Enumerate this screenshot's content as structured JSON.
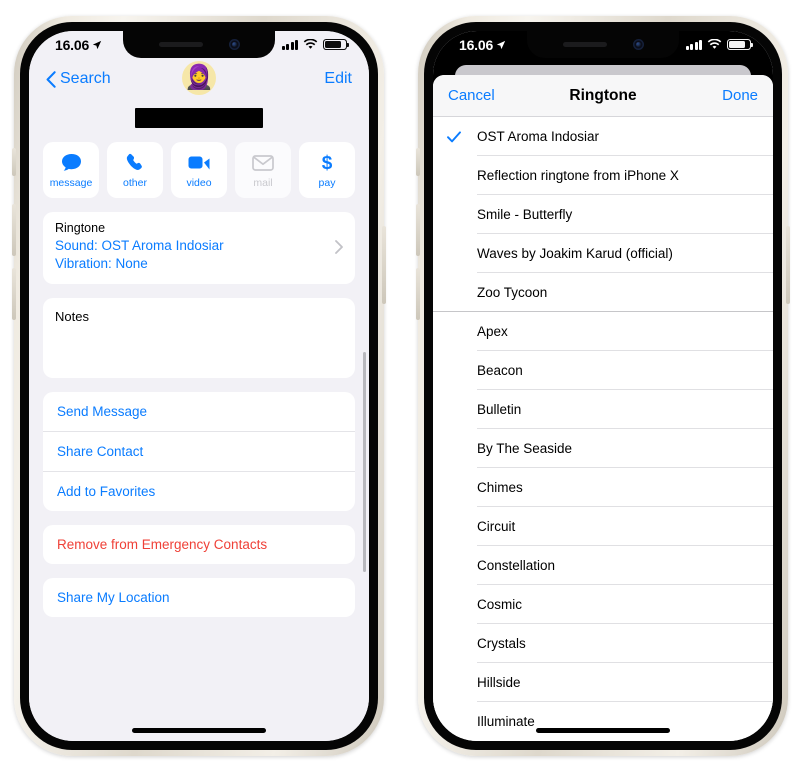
{
  "left_phone": {
    "status_bar": {
      "time": "16.06",
      "location_icon": "location-arrow-icon",
      "signal_icon": "cellular-bars-icon",
      "wifi_icon": "wifi-icon",
      "battery_icon": "battery-icon"
    },
    "nav": {
      "back_label": "Search",
      "back_icon": "chevron-left-icon",
      "avatar_icon": "contact-avatar-emoji",
      "avatar_glyph": "🧕",
      "edit_label": "Edit"
    },
    "contact_name_redacted": true,
    "actions": [
      {
        "label": "message",
        "icon": "message-bubble-icon",
        "enabled": true
      },
      {
        "label": "other",
        "icon": "phone-handset-icon",
        "enabled": true
      },
      {
        "label": "video",
        "icon": "video-camera-icon",
        "enabled": true
      },
      {
        "label": "mail",
        "icon": "envelope-icon",
        "enabled": false
      },
      {
        "label": "pay",
        "icon": "dollar-sign-icon",
        "enabled": true
      }
    ],
    "ringtone_cell": {
      "title": "Ringtone",
      "sound_line": "Sound: OST Aroma Indosiar",
      "vibration_line": "Vibration: None",
      "disclosure_icon": "chevron-right-icon"
    },
    "notes_cell": {
      "label": "Notes"
    },
    "link_groups": [
      {
        "items": [
          {
            "label": "Send Message",
            "style": "default"
          },
          {
            "label": "Share Contact",
            "style": "default"
          },
          {
            "label": "Add to Favorites",
            "style": "default"
          }
        ]
      },
      {
        "items": [
          {
            "label": "Remove from Emergency Contacts",
            "style": "destructive"
          }
        ]
      },
      {
        "items": [
          {
            "label": "Share My Location",
            "style": "default"
          }
        ]
      }
    ]
  },
  "right_phone": {
    "status_bar": {
      "time": "16.06",
      "location_icon": "location-arrow-icon",
      "signal_icon": "cellular-bars-icon",
      "wifi_icon": "wifi-icon",
      "battery_icon": "battery-icon"
    },
    "sheet": {
      "cancel_label": "Cancel",
      "title": "Ringtone",
      "done_label": "Done",
      "check_icon": "checkmark-icon",
      "tones": [
        {
          "name": "OST Aroma Indosiar",
          "selected": true,
          "section_end": false
        },
        {
          "name": "Reflection ringtone from iPhone X",
          "selected": false,
          "section_end": false
        },
        {
          "name": "Smile - Butterfly",
          "selected": false,
          "section_end": false
        },
        {
          "name": "Waves by Joakim Karud (official)",
          "selected": false,
          "section_end": false
        },
        {
          "name": "Zoo Tycoon",
          "selected": false,
          "section_end": true
        },
        {
          "name": "Apex",
          "selected": false,
          "section_end": false
        },
        {
          "name": "Beacon",
          "selected": false,
          "section_end": false
        },
        {
          "name": "Bulletin",
          "selected": false,
          "section_end": false
        },
        {
          "name": "By The Seaside",
          "selected": false,
          "section_end": false
        },
        {
          "name": "Chimes",
          "selected": false,
          "section_end": false
        },
        {
          "name": "Circuit",
          "selected": false,
          "section_end": false
        },
        {
          "name": "Constellation",
          "selected": false,
          "section_end": false
        },
        {
          "name": "Cosmic",
          "selected": false,
          "section_end": false
        },
        {
          "name": "Crystals",
          "selected": false,
          "section_end": false
        },
        {
          "name": "Hillside",
          "selected": false,
          "section_end": false
        },
        {
          "name": "Illuminate",
          "selected": false,
          "section_end": false
        }
      ]
    }
  },
  "colors": {
    "accent_blue": "#0a7cff",
    "destructive_red": "#ef4037",
    "screen_background": "#f2f1f6",
    "card_white": "#ffffff",
    "separator": "#e0e0e3",
    "disabled_gray": "#c9c9ce"
  }
}
